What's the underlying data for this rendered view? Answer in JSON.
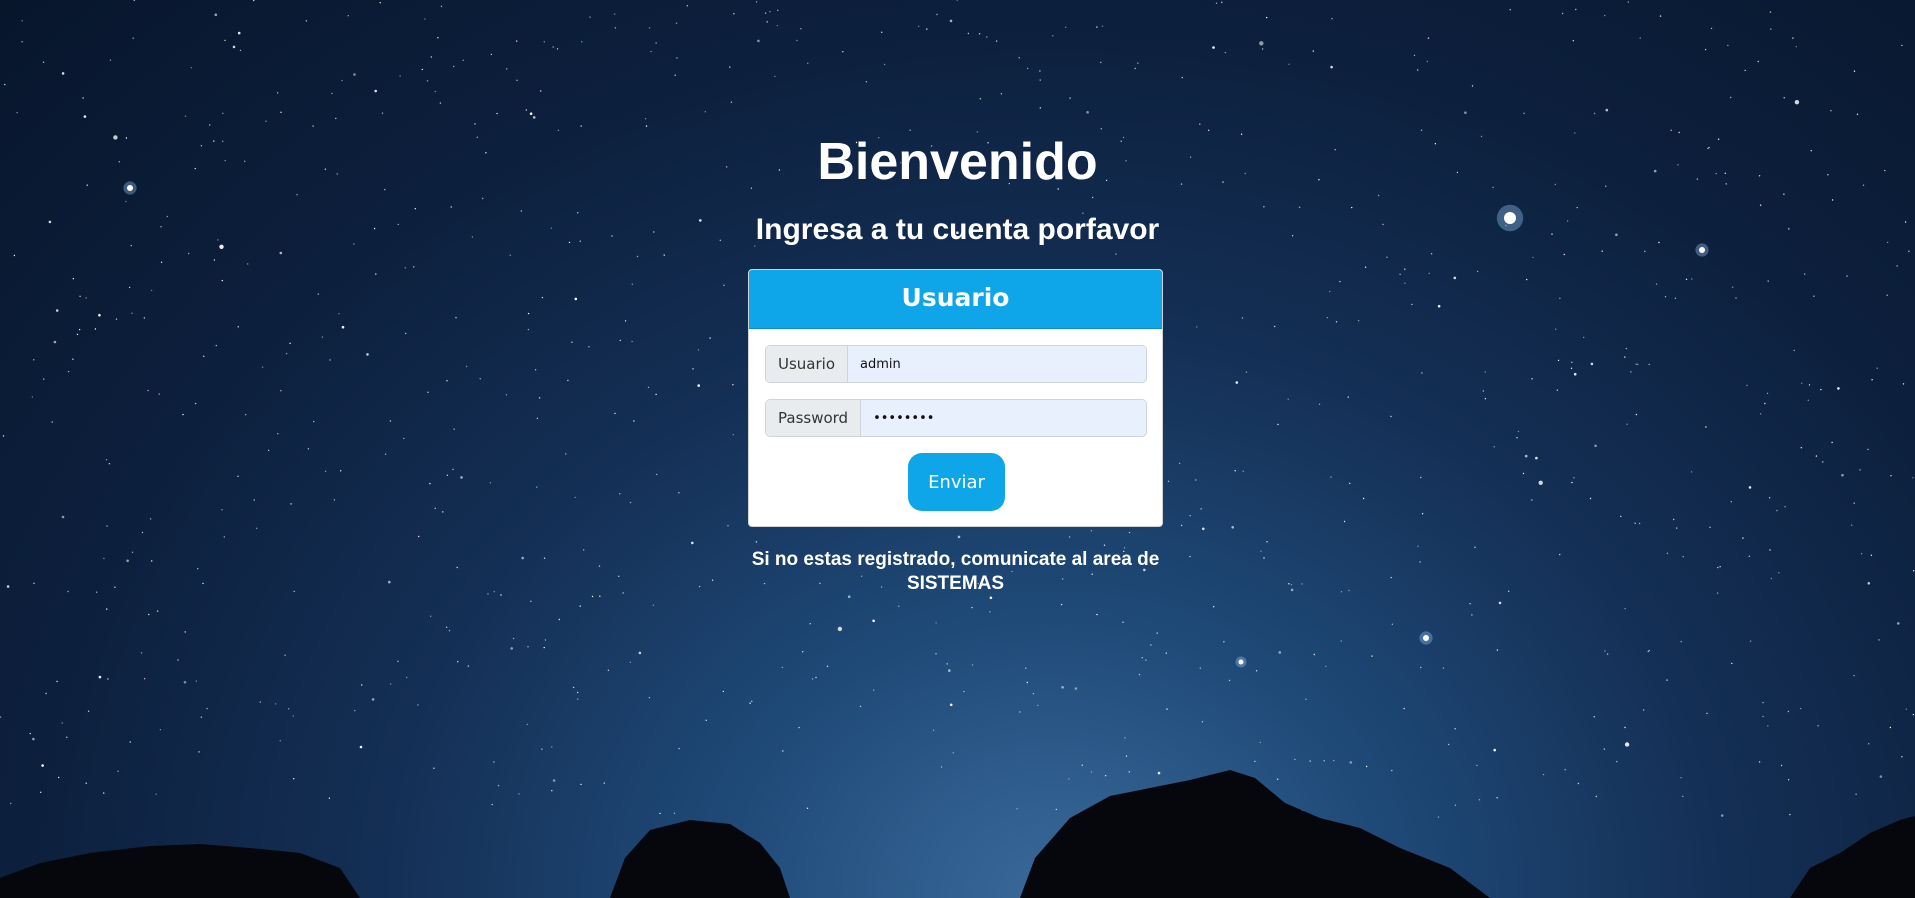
{
  "page": {
    "title": "Bienvenido",
    "subtitle": "Ingresa a tu cuenta porfavor"
  },
  "login_card": {
    "header": "Usuario",
    "user_field": {
      "label": "Usuario",
      "value": "admin"
    },
    "password_field": {
      "label": "Password",
      "value": "••••••••"
    },
    "submit_label": "Enviar"
  },
  "footer_note": "Si no estas registrado, comunicate al area de SISTEMAS",
  "colors": {
    "accent": "#0ea5e9",
    "input_bg": "#e8f0fe",
    "sky_dark": "#08162c",
    "sky_light": "#3a6a9a"
  }
}
